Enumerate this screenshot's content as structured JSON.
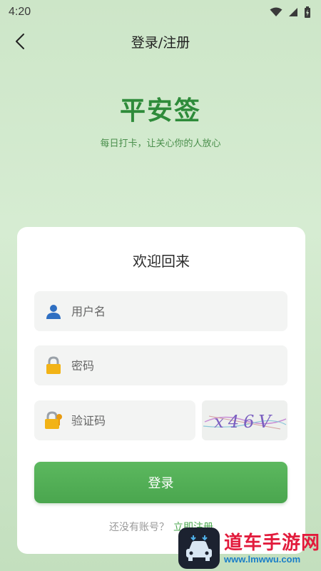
{
  "status_bar": {
    "time": "4:20"
  },
  "app_bar": {
    "title": "登录/注册"
  },
  "hero": {
    "title": "平安签",
    "subtitle": "每日打卡，让关心你的人放心"
  },
  "login_card": {
    "title": "欢迎回来",
    "username_placeholder": "用户名",
    "password_placeholder": "密码",
    "captcha_placeholder": "验证码",
    "captcha_code": "x46V",
    "login_button": "登录",
    "no_account_text": "还没有账号？",
    "register_link": "立即注册"
  },
  "watermark": {
    "name": "道车手游网",
    "url": "www.lmwwu.com"
  },
  "colors": {
    "accent": "#4aa64e",
    "hero_title": "#2e8b3a",
    "background": "#cde6c8"
  }
}
